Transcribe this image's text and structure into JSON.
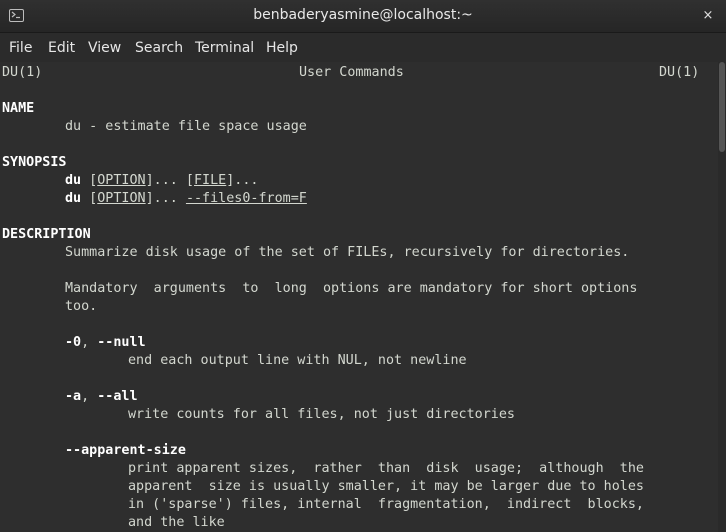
{
  "window": {
    "title": "benbaderyasmine@localhost:~",
    "close_glyph": "×"
  },
  "menu": [
    "File",
    "Edit",
    "View",
    "Search",
    "Terminal",
    "Help"
  ],
  "man": {
    "header_left": "DU(1)",
    "header_center": "User Commands",
    "header_right": "DU(1)",
    "name_heading": "NAME",
    "name_text": "du - estimate file space usage",
    "synopsis_heading": "SYNOPSIS",
    "syn1_cmd": "du",
    "syn1_opt": "OPTION",
    "syn1_mid": "]... [",
    "syn1_file": "FILE",
    "syn1_end": "]...",
    "syn2_cmd": "du",
    "syn2_opt": "OPTION",
    "syn2_mid": "]... ",
    "syn2_files0": "--files0-from=F",
    "description_heading": "DESCRIPTION",
    "desc1": "Summarize disk usage of the set of FILEs, recursively for directories.",
    "desc2": "Mandatory  arguments  to  long  options are mandatory for short options",
    "desc2b": "too.",
    "opt0_short": "-0",
    "opt0_long": "--null",
    "opt0_desc": "end each output line with NUL, not newline",
    "opta_short": "-a",
    "opta_long": "--all",
    "opta_desc": "write counts for all files, not just directories",
    "optapp": "--apparent-size",
    "optapp_d1": "print apparent sizes,  rather  than  disk  usage;  although  the",
    "optapp_d2": "apparent  size is usually smaller, it may be larger due to holes",
    "optapp_d3": "in ('sparse') files, internal  fragmentation,  indirect  blocks,",
    "optapp_d4": "and the like"
  }
}
